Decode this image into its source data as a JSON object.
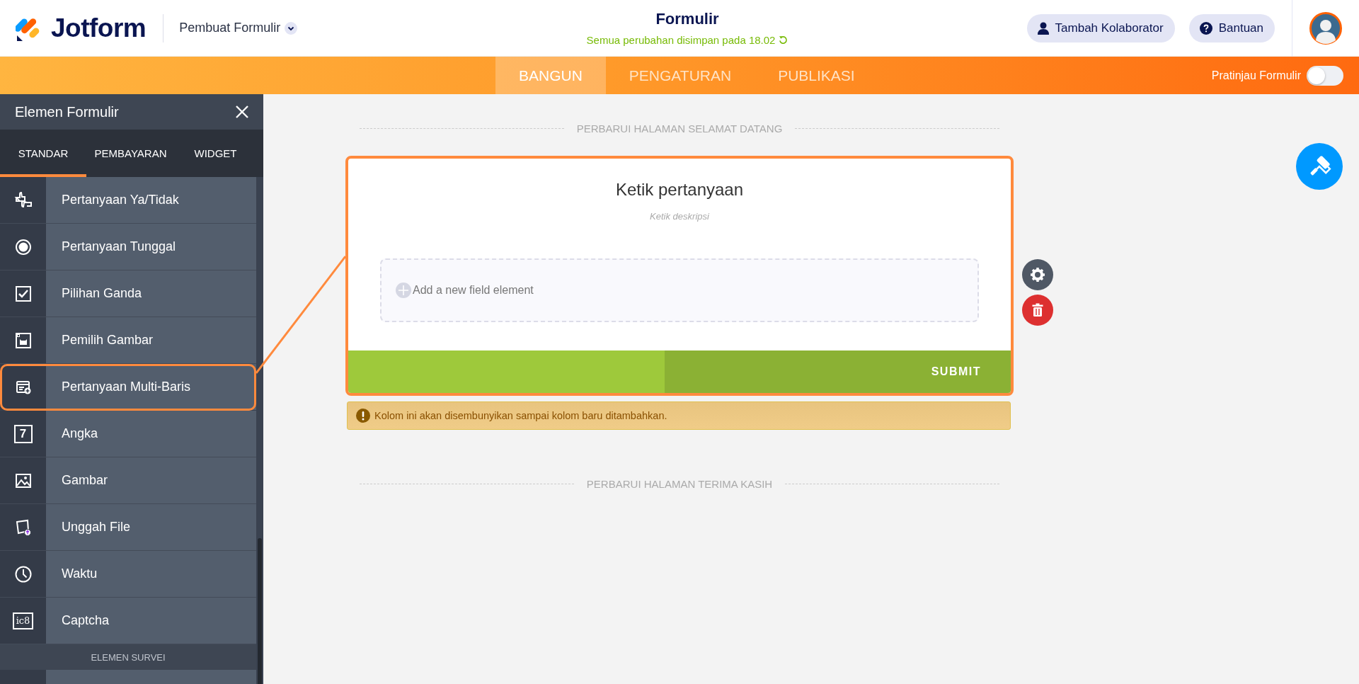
{
  "header": {
    "logo": "Jotform",
    "app_menu": "Pembuat Formulir",
    "title": "Formulir",
    "save_status": "Semua perubahan disimpan pada 18.02",
    "buttons": [
      {
        "label": "Tambah Kolaborator",
        "kind": "person"
      },
      {
        "label": "Bantuan",
        "kind": "help"
      }
    ]
  },
  "nav": {
    "tabs": [
      {
        "label": "BANGUN",
        "selected": true
      },
      {
        "label": "PENGATURAN",
        "selected": false
      },
      {
        "label": "PUBLIKASI",
        "selected": false
      }
    ],
    "preview": {
      "label": "Pratinjau Formulir",
      "on": false
    }
  },
  "sidebar": {
    "title": "Elemen Formulir",
    "tabs": [
      {
        "label": "STANDAR",
        "selected": true
      },
      {
        "label": "PEMBAYARAN",
        "selected": false
      },
      {
        "label": "WIDGET",
        "selected": false
      }
    ],
    "items": [
      {
        "label": "Pertanyaan Ya/Tidak",
        "kind": "yesno",
        "selected": false
      },
      {
        "label": "Pertanyaan Tunggal",
        "kind": "radio",
        "selected": false
      },
      {
        "label": "Pilihan Ganda",
        "kind": "checkbox",
        "selected": false
      },
      {
        "label": "Pemilih Gambar",
        "kind": "imagepicker",
        "selected": false
      },
      {
        "label": "Pertanyaan Multi-Baris",
        "kind": "multiline",
        "selected": true
      },
      {
        "label": "Angka",
        "kind": "number",
        "icon_glyph": "7",
        "selected": false
      },
      {
        "label": "Gambar",
        "kind": "image",
        "selected": false
      },
      {
        "label": "Unggah File",
        "kind": "upload",
        "selected": false
      },
      {
        "label": "Waktu",
        "kind": "time",
        "selected": false
      },
      {
        "label": "Captcha",
        "kind": "captcha",
        "icon_glyph": "ic8",
        "selected": false
      }
    ],
    "section": "ELEMEN SURVEI"
  },
  "canvas": {
    "welcome_link": "PERBARUI HALAMAN SELAMAT DATANG",
    "card": {
      "question": "Ketik pertanyaan",
      "description_placeholder": "Ketik deskripsi",
      "add_field": "Add a new field element",
      "submit": "SUBMIT"
    },
    "warning": "Kolom ini akan disembunyikan sampai kolom baru ditambahkan.",
    "thanks_link": "PERBARUI HALAMAN TERIMA KASIH"
  }
}
